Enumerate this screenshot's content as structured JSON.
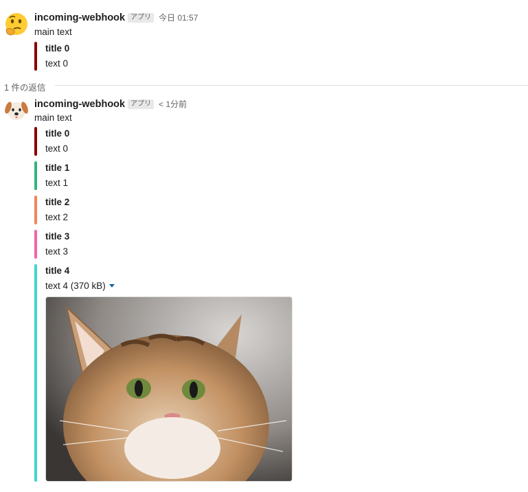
{
  "message1": {
    "sender": "incoming-webhook",
    "badge": "アプリ",
    "time": "今日 01:57",
    "avatar_icon": "thinking-face-emoji",
    "text": "main text",
    "attachments": [
      {
        "title": "title 0",
        "text": "text 0",
        "color": "#8b0000"
      }
    ]
  },
  "divider": {
    "label": "1 件の返信"
  },
  "message2": {
    "sender": "incoming-webhook",
    "badge": "アプリ",
    "time": "< 1分前",
    "avatar_icon": "dog-face-emoji",
    "text": "main text",
    "attachments": [
      {
        "title": "title 0",
        "text": "text 0",
        "color": "#8b0000"
      },
      {
        "title": "title 1",
        "text": "text 1",
        "color": "#2eb67d"
      },
      {
        "title": "title 2",
        "text": "text 2",
        "color": "#f2845c"
      },
      {
        "title": "title 3",
        "text": "text 3",
        "color": "#f064a8"
      },
      {
        "title": "title 4",
        "text": "text 4 (370 kB)",
        "color": "#40d6c8",
        "image_icon": "cat-photo"
      }
    ]
  }
}
